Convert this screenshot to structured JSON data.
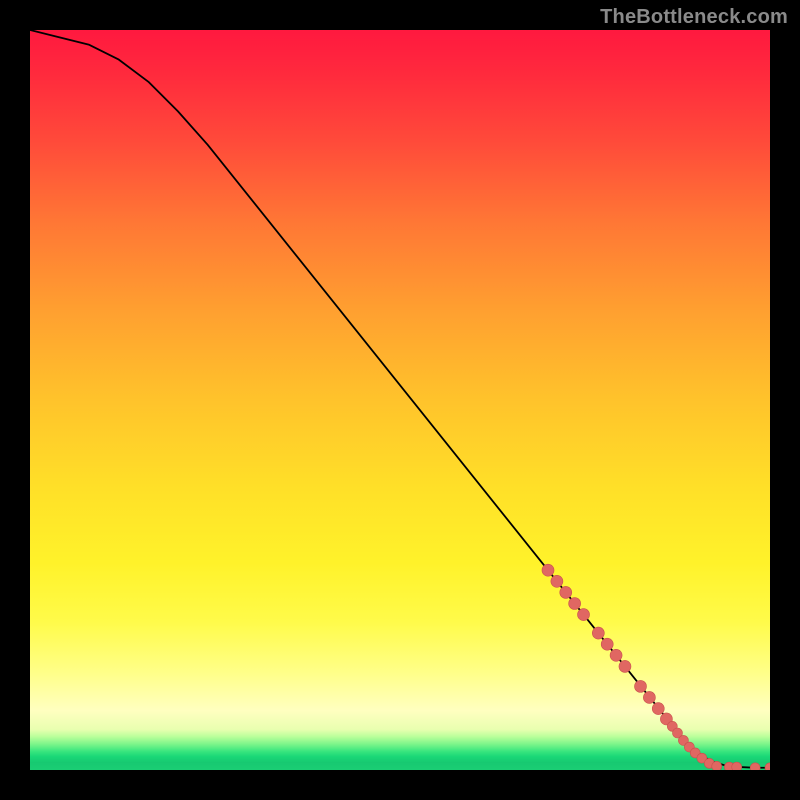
{
  "watermark": "TheBottleneck.com",
  "chart_data": {
    "type": "line",
    "title": "",
    "xlabel": "",
    "ylabel": "",
    "xlim": [
      0,
      100
    ],
    "ylim": [
      0,
      100
    ],
    "grid": false,
    "legend": false,
    "series": [
      {
        "name": "curve",
        "x": [
          0,
          4,
          8,
          12,
          16,
          20,
          24,
          28,
          32,
          36,
          40,
          44,
          48,
          52,
          56,
          60,
          64,
          68,
          72,
          76,
          80,
          84,
          86,
          88,
          90,
          92,
          94,
          96,
          98,
          100
        ],
        "y": [
          100,
          99,
          98,
          96,
          93,
          89,
          84.5,
          79.5,
          74.5,
          69.5,
          64.5,
          59.5,
          54.5,
          49.5,
          44.5,
          39.5,
          34.5,
          29.5,
          24.5,
          19.5,
          14.5,
          9.5,
          7.0,
          4.5,
          2.5,
          1.2,
          0.6,
          0.4,
          0.3,
          0.3
        ]
      }
    ],
    "markers": {
      "name": "highlighted-points",
      "color": "#e06762",
      "points": [
        {
          "x": 70.0,
          "y": 27.0,
          "r": 6
        },
        {
          "x": 71.2,
          "y": 25.5,
          "r": 6
        },
        {
          "x": 72.4,
          "y": 24.0,
          "r": 6
        },
        {
          "x": 73.6,
          "y": 22.5,
          "r": 6
        },
        {
          "x": 74.8,
          "y": 21.0,
          "r": 6
        },
        {
          "x": 76.8,
          "y": 18.5,
          "r": 6
        },
        {
          "x": 78.0,
          "y": 17.0,
          "r": 6
        },
        {
          "x": 79.2,
          "y": 15.5,
          "r": 6
        },
        {
          "x": 80.4,
          "y": 14.0,
          "r": 6
        },
        {
          "x": 82.5,
          "y": 11.3,
          "r": 6
        },
        {
          "x": 83.7,
          "y": 9.8,
          "r": 6
        },
        {
          "x": 84.9,
          "y": 8.3,
          "r": 6
        },
        {
          "x": 86.0,
          "y": 6.9,
          "r": 6
        },
        {
          "x": 86.8,
          "y": 5.9,
          "r": 5
        },
        {
          "x": 87.5,
          "y": 5.0,
          "r": 5
        },
        {
          "x": 88.3,
          "y": 4.0,
          "r": 5
        },
        {
          "x": 89.1,
          "y": 3.1,
          "r": 5
        },
        {
          "x": 89.9,
          "y": 2.3,
          "r": 5
        },
        {
          "x": 90.8,
          "y": 1.6,
          "r": 5
        },
        {
          "x": 91.8,
          "y": 0.9,
          "r": 5
        },
        {
          "x": 92.8,
          "y": 0.5,
          "r": 5
        },
        {
          "x": 94.5,
          "y": 0.4,
          "r": 5
        },
        {
          "x": 95.5,
          "y": 0.4,
          "r": 5
        },
        {
          "x": 98.0,
          "y": 0.3,
          "r": 5
        },
        {
          "x": 100.0,
          "y": 0.3,
          "r": 5
        }
      ]
    },
    "background_gradient": {
      "direction": "vertical",
      "stops": [
        {
          "pos": 0.0,
          "color": "#ff193f"
        },
        {
          "pos": 0.5,
          "color": "#ffc32b"
        },
        {
          "pos": 0.8,
          "color": "#fffb4a"
        },
        {
          "pos": 0.95,
          "color": "#b9ff9a"
        },
        {
          "pos": 1.0,
          "color": "#1bce74"
        }
      ]
    }
  }
}
